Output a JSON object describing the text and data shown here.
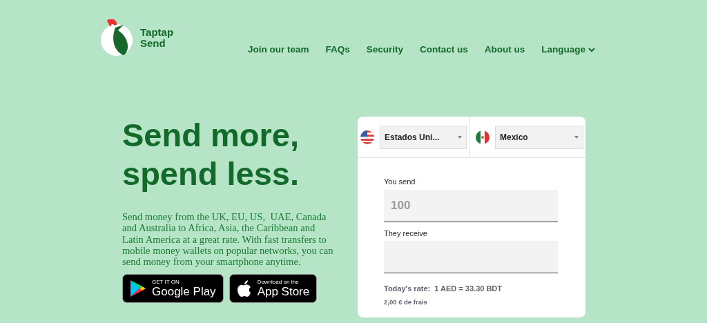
{
  "brand": {
    "name": "Taptap Send"
  },
  "nav": [
    {
      "label": "Join our team",
      "kind": "link"
    },
    {
      "label": "FAQs",
      "kind": "link"
    },
    {
      "label": "Security",
      "kind": "link"
    },
    {
      "label": "Contact us",
      "kind": "link"
    },
    {
      "label": "About us",
      "kind": "link"
    },
    {
      "label": "Language",
      "kind": "dropdown"
    }
  ],
  "hero": {
    "heading": "Send more, spend less.",
    "text": "Send money from the UK, EU, US,  UAE, Canada and Australia to Africa, Asia, the Caribbean and Latin America at a great rate. With fast transfers to mobile money wallets on popular networks, you can send money from your smartphone anytime."
  },
  "stores": [
    {
      "kind": "google",
      "small": "GET IT ON",
      "big": "Google Play"
    },
    {
      "kind": "apple",
      "small": "Download on the",
      "big": "App Store"
    }
  ],
  "converter": {
    "from_country": {
      "kind": "usa",
      "value": "Estados Uni..."
    },
    "to_country": {
      "kind": "mexico",
      "value": "Mexico"
    },
    "fields": [
      {
        "label": "You send",
        "placeholder": "100"
      },
      {
        "label": "They receive"
      }
    ],
    "rate": "Today's rate:  1 AED = 33.30 BDT",
    "fee": "2,00 € de frais"
  }
}
